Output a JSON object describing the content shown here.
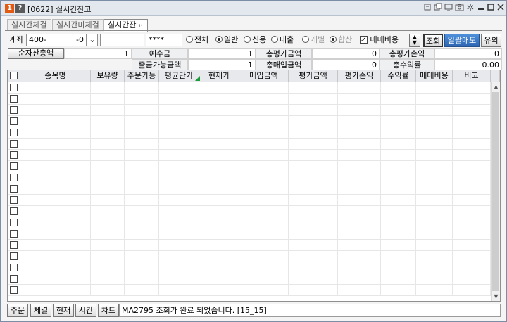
{
  "window": {
    "number_badge": "1",
    "help_badge": "?",
    "title": "[0622] 실시간잔고",
    "title_icons": [
      "pin-icon",
      "copy-icon",
      "screen-icon",
      "camera-icon",
      "gear-icon",
      "minimize-icon",
      "maximize-icon",
      "close-icon"
    ]
  },
  "tabs": [
    {
      "label": "실시간체결",
      "active": false
    },
    {
      "label": "실시간미체결",
      "active": false
    },
    {
      "label": "실시간잔고",
      "active": true
    }
  ],
  "account": {
    "label": "계좌",
    "number": "400-",
    "suffix": "-0",
    "name": "",
    "password": "****",
    "filters": [
      {
        "label": "전체",
        "selected": false,
        "disabled": false
      },
      {
        "label": "일반",
        "selected": true,
        "disabled": false
      },
      {
        "label": "신용",
        "selected": false,
        "disabled": false
      },
      {
        "label": "대출",
        "selected": false,
        "disabled": false
      }
    ],
    "modes": [
      {
        "label": "개별",
        "selected": false,
        "disabled": true
      },
      {
        "label": "합산",
        "selected": true,
        "disabled": true
      }
    ],
    "fee_checkbox": {
      "label": "매매비용",
      "checked": true
    },
    "query_button": "조회",
    "sell_all_button": "일괄매도",
    "notes_button": "유의"
  },
  "summary": {
    "net_asset_button": "순자산총액",
    "row1": [
      {
        "value": "1"
      },
      {
        "key": "예수금",
        "value": "1"
      },
      {
        "key": "총평가금액",
        "value": "0"
      },
      {
        "key": "총평가손익",
        "value": "0"
      }
    ],
    "row2": [
      {
        "key": "출금가능금액",
        "value": "1"
      },
      {
        "key": "총매입금액",
        "value": "0"
      },
      {
        "key": "총수익률",
        "value": "0.00"
      }
    ]
  },
  "table": {
    "columns": [
      "종목명",
      "보유량",
      "주문가능",
      "평균단가",
      "현재가",
      "매입금액",
      "평가금액",
      "평가손익",
      "수익률",
      "매매비용",
      "비고"
    ],
    "row_count": 19
  },
  "bottom": {
    "buttons": [
      "주문",
      "체결",
      "현재",
      "시간",
      "차트"
    ],
    "status": "MA2795 조회가 완료 되었습니다. [15_15]"
  }
}
